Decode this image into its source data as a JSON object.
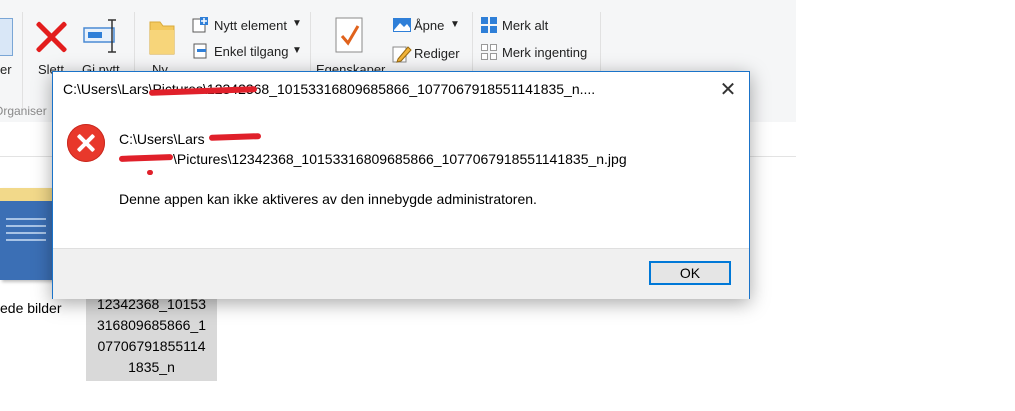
{
  "ribbon": {
    "partial_left_label": "er",
    "delete_label": "Slett",
    "rename_label": "Gi nytt",
    "organize_label": "Organiser",
    "new_label": "Ny",
    "new_item_label": "Nytt element",
    "easy_access_label": "Enkel tilgang",
    "properties_label": "Egenskaper",
    "open_label": "Åpne",
    "edit_label": "Rediger",
    "select_all_label": "Merk alt",
    "select_none_label": "Merk ingenting"
  },
  "files": {
    "folder_label": "ede bilder",
    "selected_file_name_lines": [
      "12342368_10153",
      "316809685866_1",
      "07706791855114",
      "1835_n"
    ]
  },
  "dialog": {
    "title": "C:\\Users\\Lars\\Pictures\\12342368_10153316809685866_1077067918551141835_n....",
    "path_line_1": "C:\\Users\\Lars",
    "path_line_2": "\\Pictures\\12342368_10153316809685866_1077067918551141835_n.jpg",
    "message": "Denne appen kan ikke aktiveres av den innebygde administratoren.",
    "ok_label": "OK",
    "close_glyph": "✕"
  },
  "colors": {
    "dialog_border": "#1a73c9",
    "error_red": "#e8382b",
    "button_focus": "#0078d7",
    "redaction": "#e0202a"
  },
  "icons": [
    "delete-icon",
    "rename-icon",
    "new-folder-icon",
    "new-item-icon",
    "easy-access-icon",
    "properties-icon",
    "open-icon",
    "edit-icon",
    "select-all-icon",
    "select-none-icon",
    "error-icon",
    "close-icon"
  ]
}
